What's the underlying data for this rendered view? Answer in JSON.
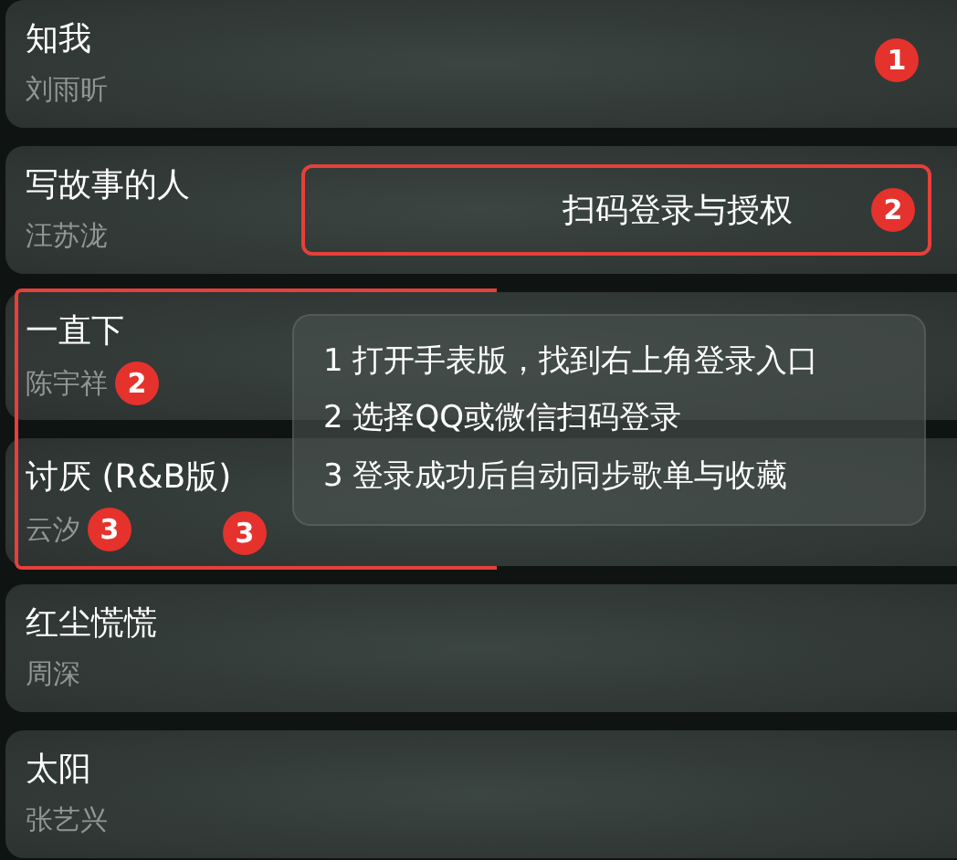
{
  "songs": [
    {
      "title": "知我",
      "artist": "刘雨昕",
      "highlighted": false,
      "right_badge": "1"
    },
    {
      "title": "写故事的人",
      "artist": "汪苏泷",
      "highlighted": false,
      "callout": {
        "text": "扫码登录与授权",
        "badge": "2"
      }
    },
    {
      "title": "一直下",
      "artist": "陈宇祥",
      "highlighted": true,
      "artist_badge": "2"
    },
    {
      "title": "讨厌 (R&B版)",
      "artist": "云汐",
      "highlighted": true,
      "artist_badge": "3",
      "extra_badge": "3"
    },
    {
      "title": "红尘慌慌",
      "artist": "周深",
      "highlighted": false
    },
    {
      "title": "太阳",
      "artist": "张艺兴",
      "highlighted": false
    }
  ],
  "tooltip": {
    "lines": [
      "1 打开手表版，找到右上角登录入口",
      "2 选择QQ或微信扫码登录",
      "3 登录成功后自动同步歌单与收藏"
    ]
  }
}
